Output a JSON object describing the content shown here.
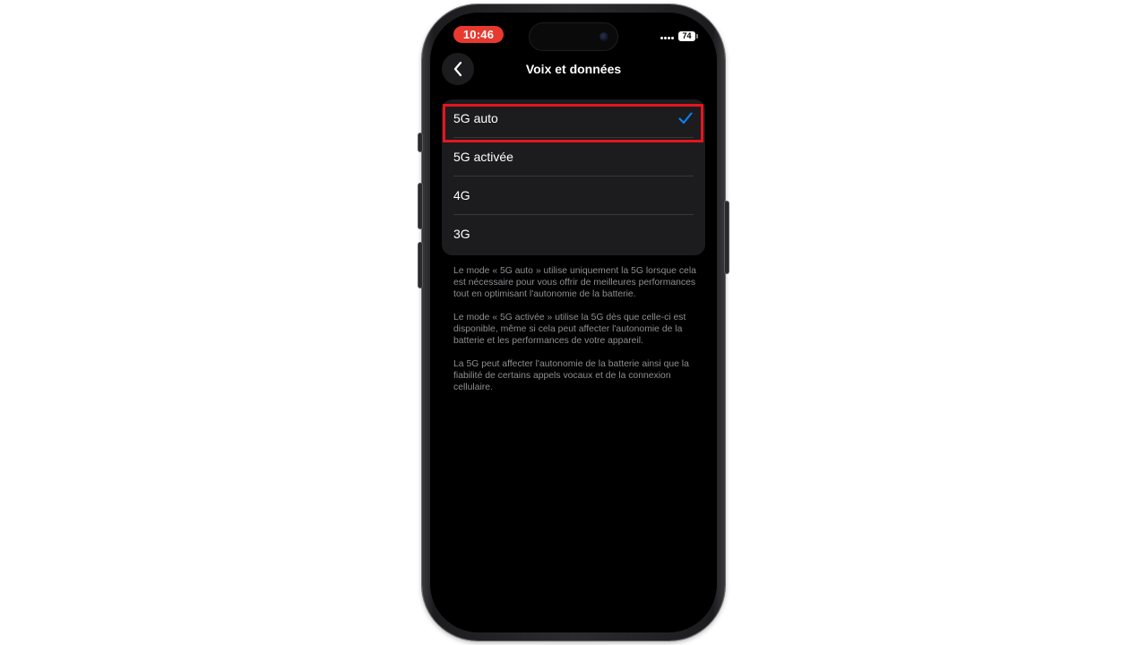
{
  "status_bar": {
    "time": "10:46",
    "battery": "74"
  },
  "nav": {
    "title": "Voix et données",
    "back_icon": "chevron-left-icon"
  },
  "options": [
    {
      "label": "5G auto",
      "selected": true
    },
    {
      "label": "5G activée",
      "selected": false
    },
    {
      "label": "4G",
      "selected": false
    },
    {
      "label": "3G",
      "selected": false
    }
  ],
  "footnotes": [
    "Le mode « 5G auto » utilise uniquement la 5G lorsque cela est nécessaire pour vous offrir de meilleures performances tout en optimisant l'autonomie de la batterie.",
    "Le mode « 5G activée » utilise la 5G dès que celle-ci est disponible, même si cela peut affecter l'autonomie de la batterie et les performances de votre appareil.",
    "La 5G peut affecter l'autonomie de la batterie ainsi que la fiabilité de certains appels vocaux et de la connexion cellulaire."
  ],
  "colors": {
    "accent": "#0a84ff",
    "highlight": "#e3151e",
    "time_pill": "#e8392f"
  }
}
